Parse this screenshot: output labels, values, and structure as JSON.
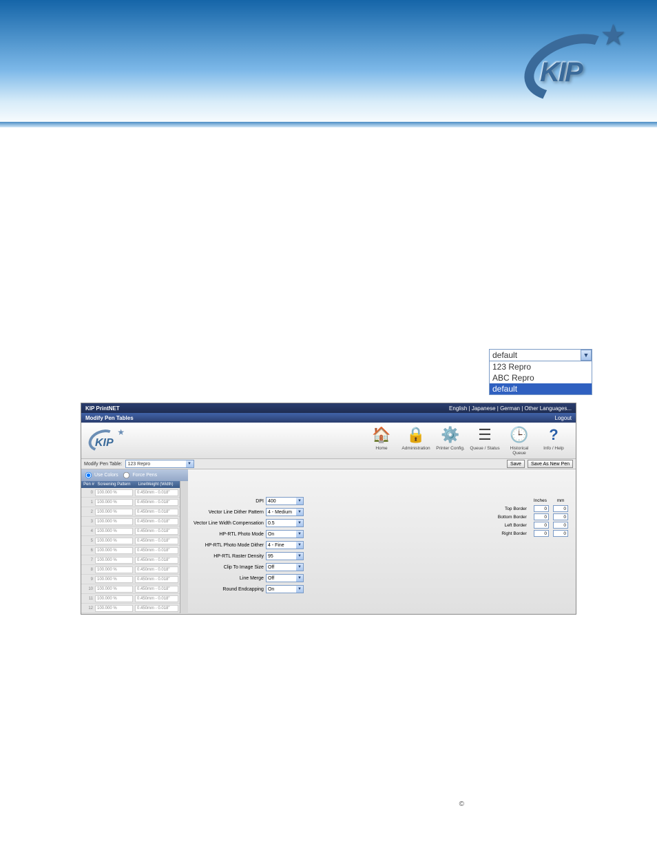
{
  "dropdown": {
    "selected": "default",
    "options": [
      "123 Repro",
      "ABC Repro",
      "default"
    ]
  },
  "app": {
    "title": "KIP PrintNET",
    "langs": [
      "English",
      "Japanese",
      "German",
      "Other Languages..."
    ],
    "subtitle": "Modify Pen Tables",
    "logout": "Logout",
    "nav": [
      {
        "label": "Home"
      },
      {
        "label": "Administration"
      },
      {
        "label": "Printer Config."
      },
      {
        "label": "Queue / Status"
      },
      {
        "label": "Historical Queue"
      },
      {
        "label": "Info / Help"
      }
    ],
    "toolbar": {
      "label": "Modify Pen Table:",
      "selected": "123 Repro",
      "save": "Save",
      "saveAsNew": "Save As New Pen"
    },
    "radios": {
      "useColors": "Use Colors",
      "forcePens": "Force Pens"
    },
    "penHeaders": {
      "c1": "Pen #",
      "c2": "Screening Pattern",
      "c3": "LineWeight (Width)"
    },
    "penRows": [
      {
        "n": "0",
        "screen": "100.000 %",
        "weight": "0.450mm - 0.018\""
      },
      {
        "n": "1",
        "screen": "100.000 %",
        "weight": "0.450mm - 0.018\""
      },
      {
        "n": "2",
        "screen": "100.000 %",
        "weight": "0.450mm - 0.018\""
      },
      {
        "n": "3",
        "screen": "100.000 %",
        "weight": "0.450mm - 0.018\""
      },
      {
        "n": "4",
        "screen": "100.000 %",
        "weight": "0.450mm - 0.018\""
      },
      {
        "n": "5",
        "screen": "100.000 %",
        "weight": "0.450mm - 0.018\""
      },
      {
        "n": "6",
        "screen": "100.000 %",
        "weight": "0.450mm - 0.018\""
      },
      {
        "n": "7",
        "screen": "100.000 %",
        "weight": "0.450mm - 0.018\""
      },
      {
        "n": "8",
        "screen": "100.000 %",
        "weight": "0.450mm - 0.018\""
      },
      {
        "n": "9",
        "screen": "100.000 %",
        "weight": "0.450mm - 0.018\""
      },
      {
        "n": "10",
        "screen": "100.000 %",
        "weight": "0.450mm - 0.018\""
      },
      {
        "n": "11",
        "screen": "100.000 %",
        "weight": "0.450mm - 0.018\""
      },
      {
        "n": "12",
        "screen": "100.000 %",
        "weight": "0.450mm - 0.018\""
      }
    ],
    "settings": [
      {
        "label": "DPI",
        "value": "400"
      },
      {
        "label": "Vector Line Dither Pattern",
        "value": "4 - Medium"
      },
      {
        "label": "Vector Line Width Compensation",
        "value": "0.5"
      },
      {
        "label": "HP-RTL Photo Mode",
        "value": "On"
      },
      {
        "label": "HP-RTL Photo Mode Dither",
        "value": "4 - Fine"
      },
      {
        "label": "HP-RTL Raster Density",
        "value": "95"
      },
      {
        "label": "Clip To Image Size",
        "value": "Off"
      },
      {
        "label": "Line Merge",
        "value": "Off"
      },
      {
        "label": "Round Endcapping",
        "value": "On"
      }
    ],
    "borders": {
      "colInches": "Inches",
      "colMm": "mm",
      "rows": [
        {
          "label": "Top Border",
          "in": "0",
          "mm": "0"
        },
        {
          "label": "Bottom Border",
          "in": "0",
          "mm": "0"
        },
        {
          "label": "Left Border",
          "in": "0",
          "mm": "0"
        },
        {
          "label": "Right Border",
          "in": "0",
          "mm": "0"
        }
      ]
    }
  },
  "copyright": "©"
}
